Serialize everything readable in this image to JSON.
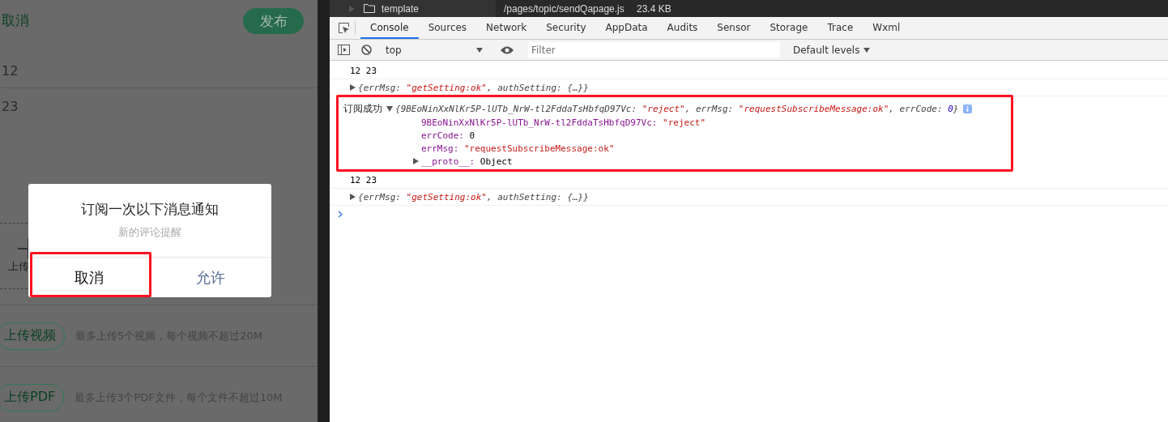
{
  "simulator": {
    "cancel": "取消",
    "publish": "发布",
    "lines": [
      "12",
      "23"
    ],
    "upload_label": "上传",
    "uploads": [
      {
        "button": "上传视频",
        "hint": "最多上传5个视频，每个视频不超过20M"
      },
      {
        "button": "上传PDF",
        "hint": "最多上传3个PDF文件，每个文件不超过10M"
      }
    ]
  },
  "dialog": {
    "title": "订阅一次以下消息通知",
    "subtitle": "新的评论提醒",
    "buttons": [
      {
        "label": "取消",
        "kind": "cancel",
        "highlighted": true
      },
      {
        "label": "允许",
        "kind": "allow",
        "highlighted": false
      }
    ]
  },
  "file_bar": {
    "folder": "template",
    "path": "/pages/topic/sendQapage.js",
    "size": "23.4 KB"
  },
  "tabs": [
    {
      "label": "Console",
      "selected": true
    },
    {
      "label": "Sources",
      "selected": false
    },
    {
      "label": "Network",
      "selected": false
    },
    {
      "label": "Security",
      "selected": false
    },
    {
      "label": "AppData",
      "selected": false
    },
    {
      "label": "Audits",
      "selected": false
    },
    {
      "label": "Sensor",
      "selected": false
    },
    {
      "label": "Storage",
      "selected": false
    },
    {
      "label": "Trace",
      "selected": false
    },
    {
      "label": "Wxml",
      "selected": false
    }
  ],
  "toolbar": {
    "context": "top",
    "filter_placeholder": "Filter",
    "levels": "Default levels"
  },
  "console": [
    {
      "kind": "log",
      "text": "12 23"
    },
    {
      "kind": "object",
      "highlighted": false,
      "segments": [
        {
          "t": "{",
          "kind": "punct"
        },
        {
          "t": "errMsg: ",
          "kind": "key"
        },
        {
          "t": "\"getSetting:ok\"",
          "kind": "string"
        },
        {
          "t": ", ",
          "kind": "punct"
        },
        {
          "t": "authSetting: ",
          "kind": "key"
        },
        {
          "t": "{…}}",
          "kind": "punct"
        }
      ]
    },
    {
      "kind": "group",
      "highlighted": true,
      "label": "订阅成功",
      "segments": [
        {
          "t": "{",
          "kind": "punct"
        },
        {
          "t": "9BEoNinXxNlKr5P-lUTb_NrW-tl2FddaTsHbfqD97Vc: ",
          "kind": "key"
        },
        {
          "t": "\"reject\"",
          "kind": "string"
        },
        {
          "t": ", ",
          "kind": "punct"
        },
        {
          "t": "errMsg: ",
          "kind": "key"
        },
        {
          "t": "\"requestSubscribeMessage:ok\"",
          "kind": "string"
        },
        {
          "t": ", ",
          "kind": "punct"
        },
        {
          "t": "errCode: ",
          "kind": "key"
        },
        {
          "t": "0",
          "kind": "number"
        },
        {
          "t": "}",
          "kind": "punct"
        }
      ],
      "children": [
        {
          "key": "9BEoNinXxNlKr5P-lUTb_NrW-tl2FddaTsHbfqD97Vc:",
          "value": "\"reject\"",
          "kind": "string"
        },
        {
          "key": "errCode:",
          "value": "0",
          "kind": "plain"
        },
        {
          "key": "errMsg:",
          "value": "\"requestSubscribeMessage:ok\"",
          "kind": "string"
        },
        {
          "key": "__proto__:",
          "value": "Object",
          "kind": "object"
        }
      ]
    },
    {
      "kind": "log",
      "text": "12 23"
    },
    {
      "kind": "object",
      "highlighted": false,
      "segments": [
        {
          "t": "{",
          "kind": "punct"
        },
        {
          "t": "errMsg: ",
          "kind": "key"
        },
        {
          "t": "\"getSetting:ok\"",
          "kind": "string"
        },
        {
          "t": ", ",
          "kind": "punct"
        },
        {
          "t": "authSetting: ",
          "kind": "key"
        },
        {
          "t": "{…}}",
          "kind": "punct"
        }
      ]
    },
    {
      "kind": "prompt"
    }
  ]
}
